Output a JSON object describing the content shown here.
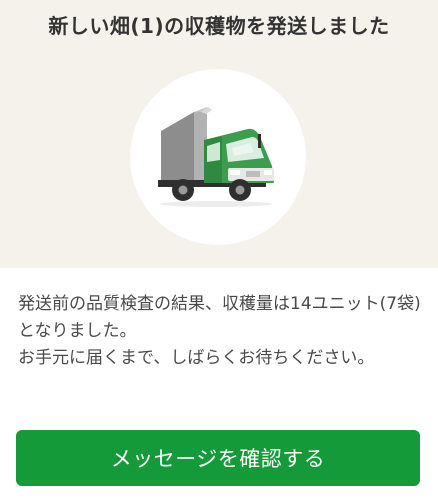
{
  "notification": {
    "title": "新しい畑(1)の収穫物を発送しました",
    "message_line_1": "発送前の品質検査の結果、収穫量は14ユニット(7袋)となりました。",
    "message_line_2": "お手元に届くまで、しばらくお待ちください。",
    "cta_label": "メッセージを確認する",
    "illustration_icon": "delivery-truck-icon"
  },
  "colors": {
    "hero_background": "#f5f2ec",
    "truck_cab_green": "#3c9e4d",
    "truck_cargo_gray": "#a5a5a5",
    "button_green": "#159a3a"
  }
}
